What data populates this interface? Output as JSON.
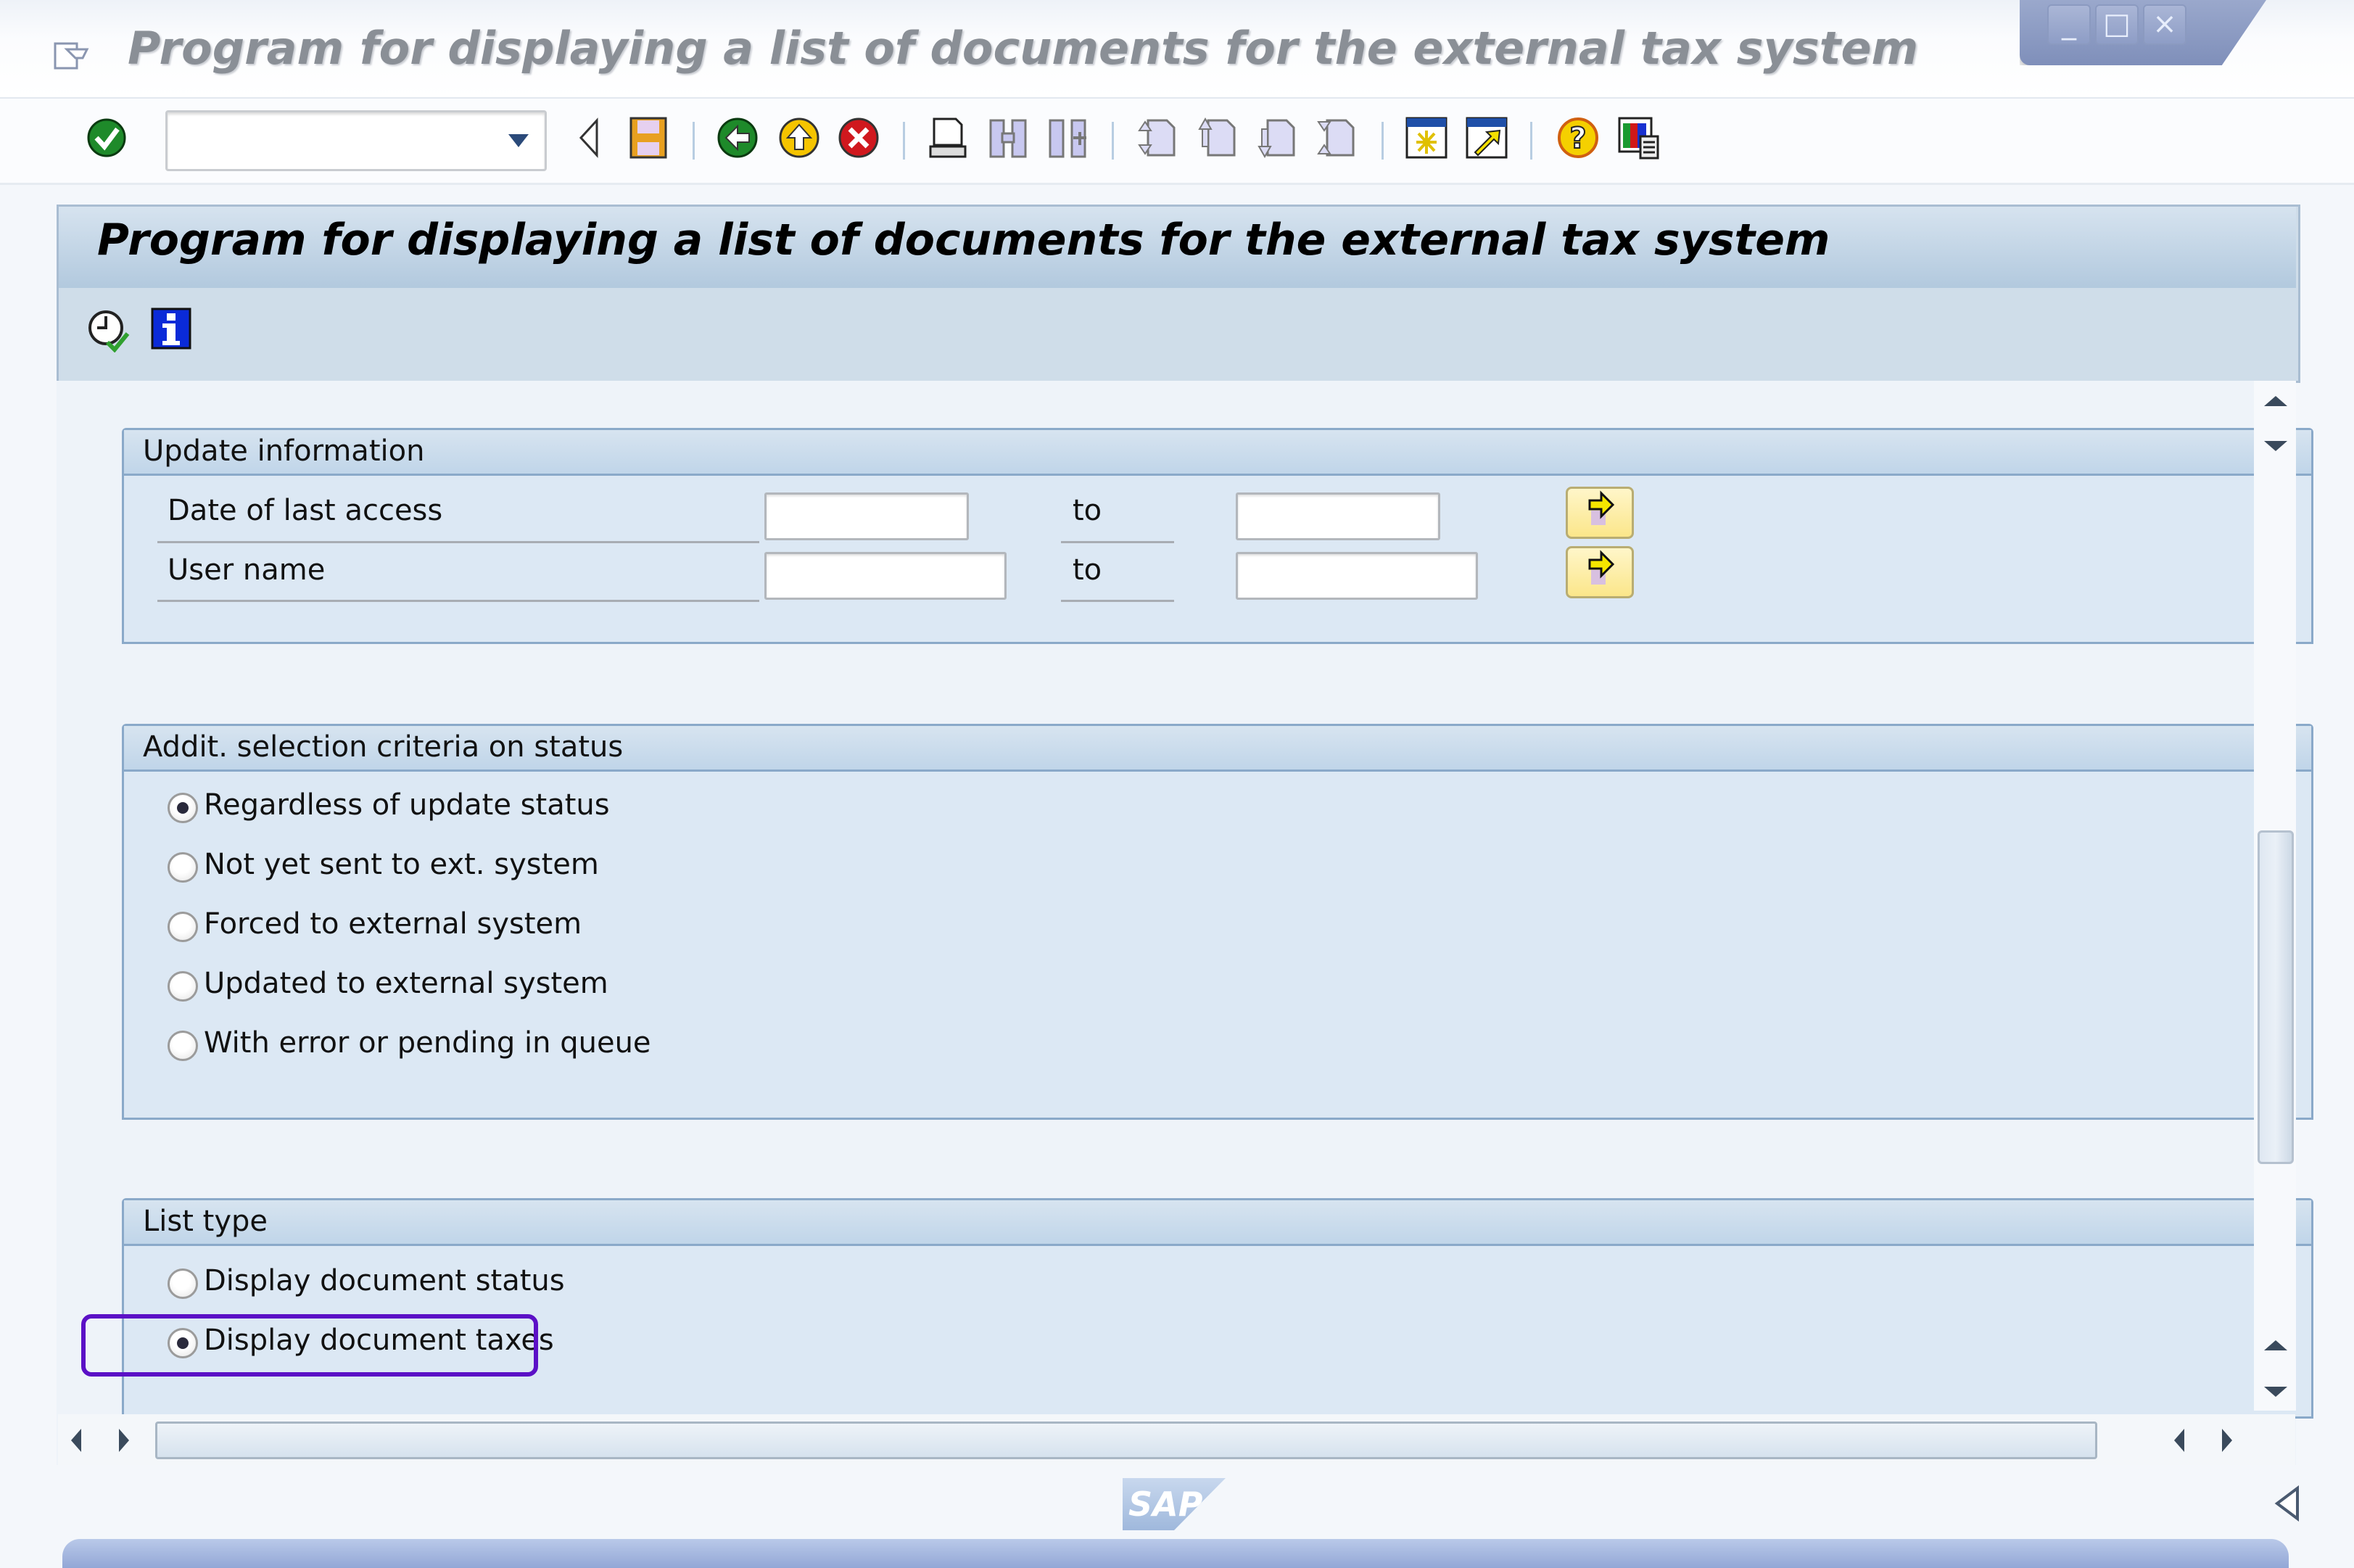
{
  "window": {
    "title": "Program for displaying a list of documents for the external tax system",
    "controls": [
      "minimize",
      "maximize",
      "close"
    ]
  },
  "toolbar": {
    "command_field_value": "",
    "icons": [
      "enter-check-icon",
      "collapse-command-field-icon",
      "save-icon",
      "back-icon",
      "exit-icon",
      "cancel-icon",
      "print-icon",
      "find-icon",
      "find-next-icon",
      "first-page-icon",
      "previous-page-icon",
      "next-page-icon",
      "last-page-icon",
      "create-session-icon",
      "generate-shortcut-icon",
      "help-icon",
      "customize-layout-icon"
    ]
  },
  "header": {
    "title": "Program for displaying a list of documents for the external tax system",
    "actions": [
      "execute-icon",
      "program-documentation-icon"
    ]
  },
  "update_information": {
    "title": "Update information",
    "rows": [
      {
        "label": "Date of last access",
        "from": "",
        "to_label": "to",
        "to": ""
      },
      {
        "label": "User name",
        "from": "",
        "to_label": "to",
        "to": ""
      }
    ]
  },
  "status_criteria": {
    "title": "Addit. selection criteria on status",
    "options": [
      {
        "label": "Regardless of update status",
        "selected": true
      },
      {
        "label": "Not yet sent to ext.  system",
        "selected": false
      },
      {
        "label": "Forced to external system",
        "selected": false
      },
      {
        "label": "Updated to external system",
        "selected": false
      },
      {
        "label": "With error or pending in queue",
        "selected": false
      }
    ]
  },
  "list_type": {
    "title": "List type",
    "options": [
      {
        "label": "Display document status",
        "selected": false
      },
      {
        "label": "Display document  taxes",
        "selected": true
      }
    ],
    "highlight_color": "#5b10c6"
  },
  "footer": {
    "logo": "SAP"
  },
  "colors": {
    "panel_bg": "#dce8f4",
    "group_border": "#8aa9c9",
    "header_bg": "#cfdde9"
  }
}
